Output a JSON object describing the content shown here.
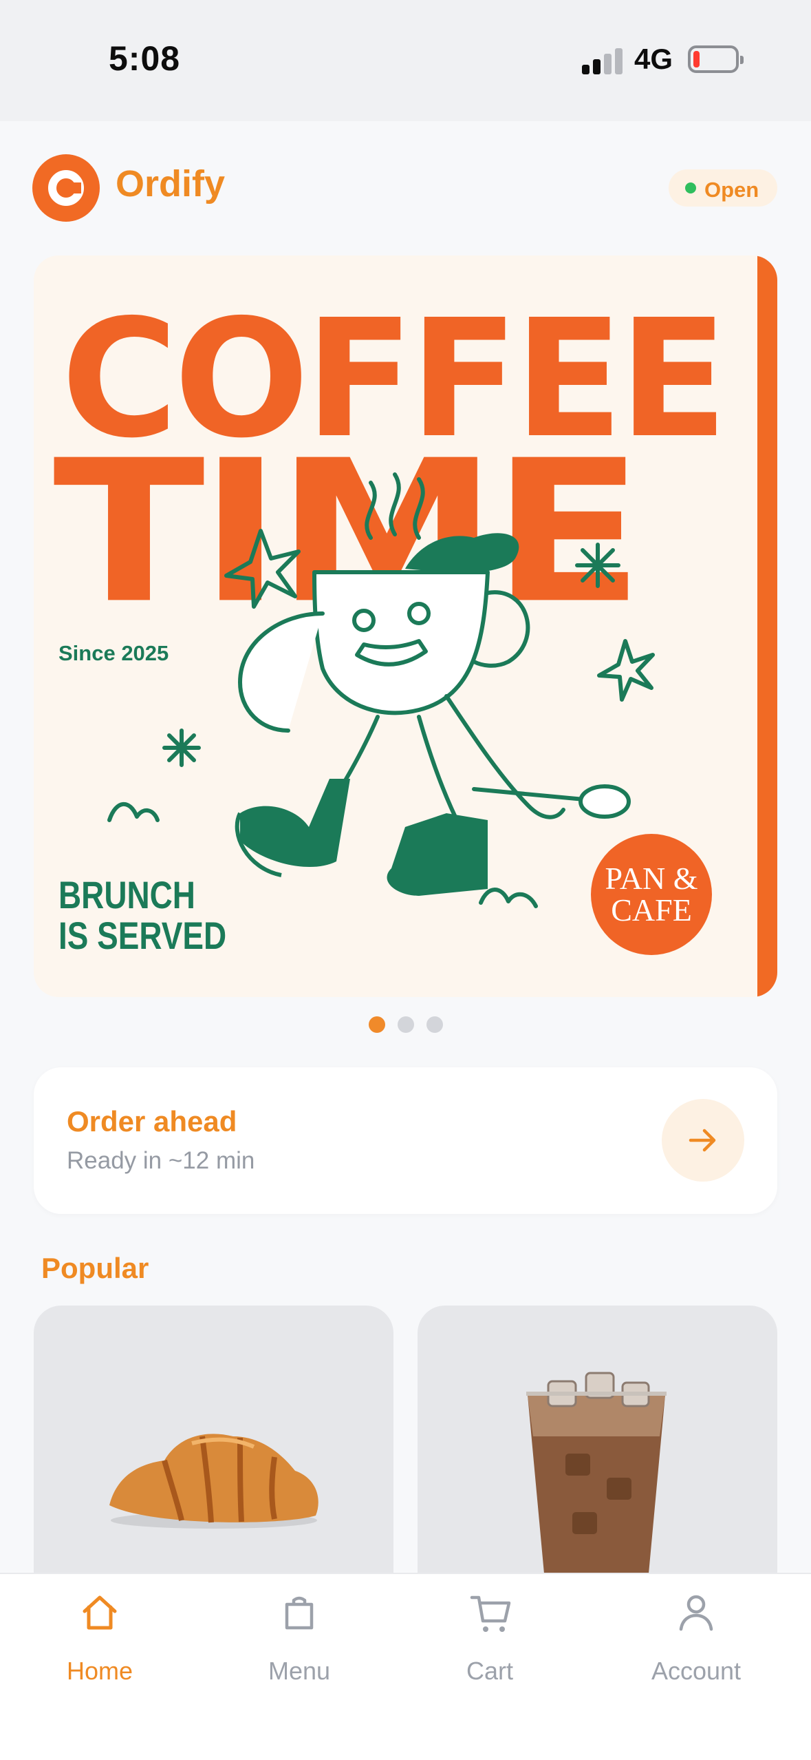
{
  "status_bar": {
    "time": "5:08",
    "network": "4G",
    "battery_level": 0.1
  },
  "header": {
    "brand": "Ordify",
    "status_label": "Open",
    "status_color": "#2fbe5e",
    "accent": "#ef8a23"
  },
  "banner": {
    "headline_1": "COFFEE",
    "headline_2": "TIME",
    "since": "Since 2025",
    "tagline": "BRUNCH\nIS SERVED",
    "badge": "PAN &\nCAFE",
    "active_page": 1,
    "pages": 3
  },
  "order_ahead": {
    "title": "Order ahead",
    "subtitle": "Ready in ~12 min",
    "icon": "arrow-right-icon"
  },
  "popular": {
    "title": "Popular",
    "items": [
      {
        "image": "croissant"
      },
      {
        "image": "iced-coffee"
      }
    ]
  },
  "tab_bar": {
    "items": [
      {
        "label": "Home",
        "icon": "home-icon",
        "active": true
      },
      {
        "label": "Menu",
        "icon": "bag-icon",
        "active": false
      },
      {
        "label": "Cart",
        "icon": "cart-icon",
        "active": false
      },
      {
        "label": "Account",
        "icon": "person-icon",
        "active": false
      }
    ]
  }
}
